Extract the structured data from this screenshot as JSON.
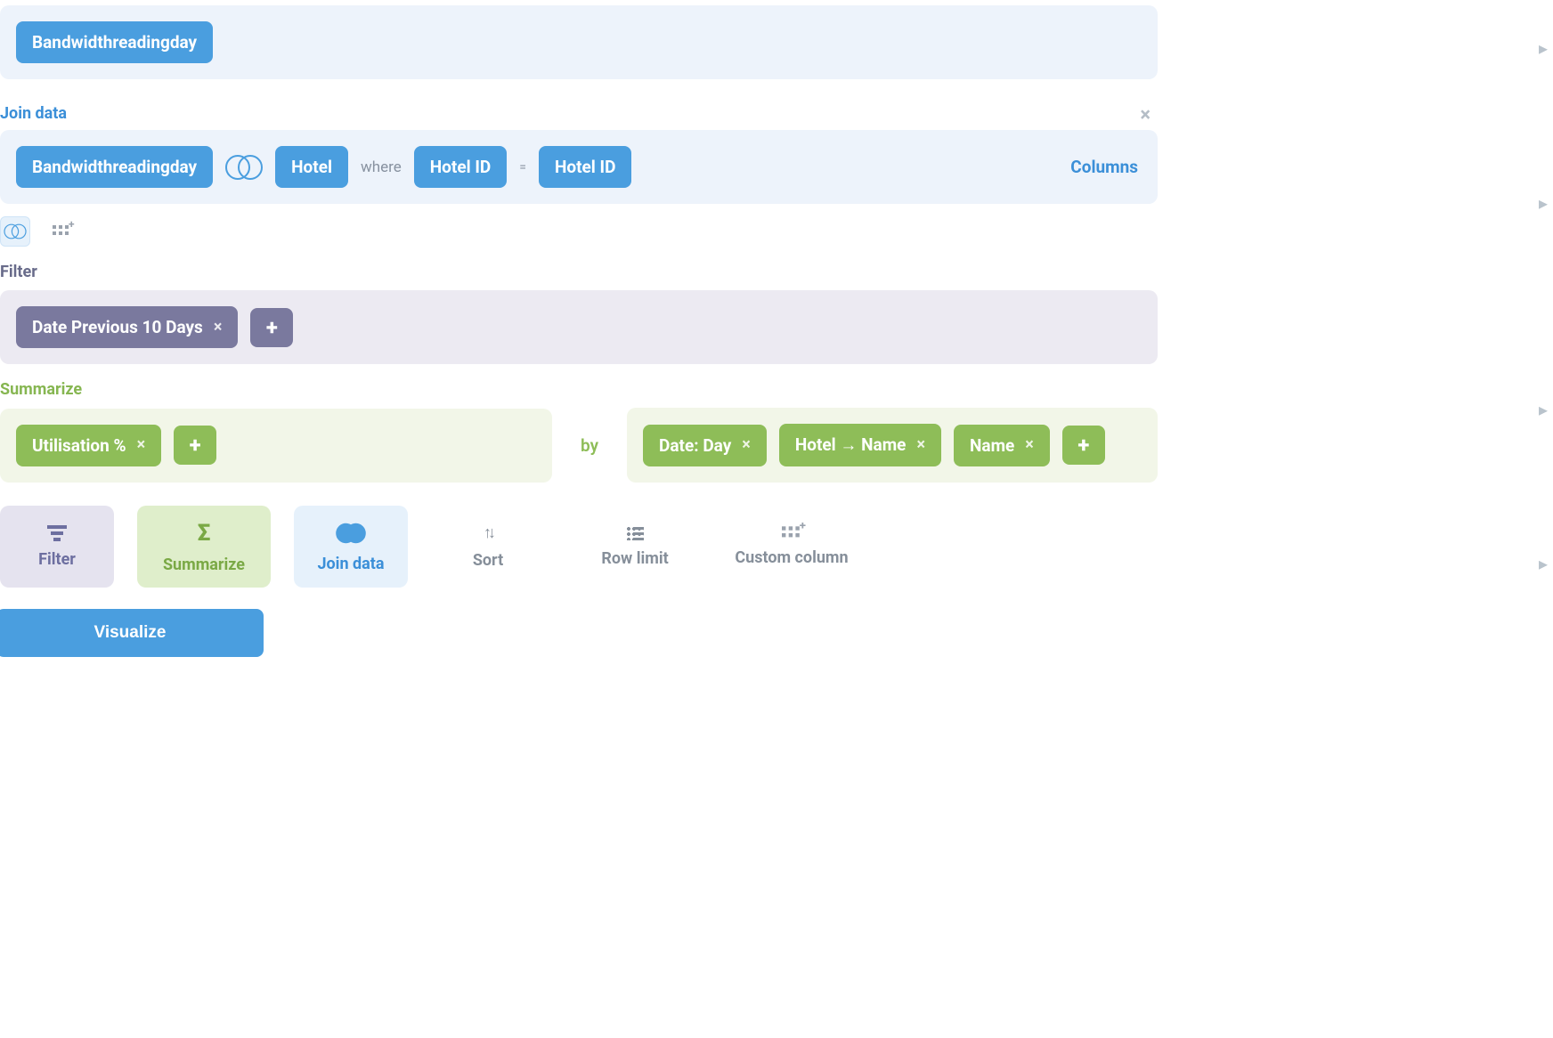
{
  "data": {
    "chip": "Bandwidthreadingday"
  },
  "join": {
    "title": "Join data",
    "left": "Bandwidthreadingday",
    "right": "Hotel",
    "where": "where",
    "leftCol": "Hotel ID",
    "eq": "=",
    "rightCol": "Hotel ID",
    "columnsLink": "Columns"
  },
  "filter": {
    "title": "Filter",
    "chips": [
      {
        "label": "Date Previous 10 Days"
      }
    ]
  },
  "summarize": {
    "title": "Summarize",
    "aggs": [
      {
        "label": "Utilisation %"
      }
    ],
    "by": "by",
    "groups": [
      {
        "label": "Date: Day"
      },
      {
        "label": "Hotel → Name"
      },
      {
        "label": "Name"
      }
    ]
  },
  "actions": {
    "filter": "Filter",
    "summarize": "Summarize",
    "join": "Join data",
    "sort": "Sort",
    "rowlimit": "Row limit",
    "customcol": "Custom column"
  },
  "visualize": "Visualize"
}
